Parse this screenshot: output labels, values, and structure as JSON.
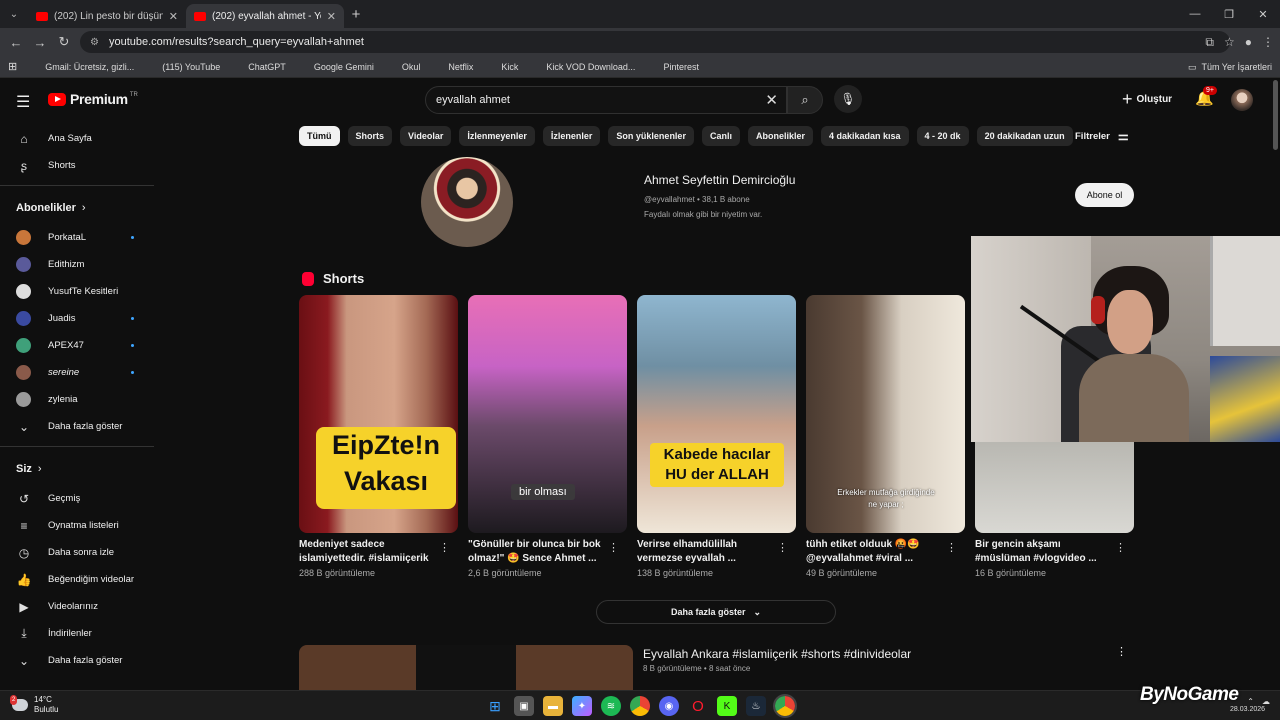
{
  "browser": {
    "tabs": [
      {
        "label": "(202) Lin pesto bir düşün - YouTube",
        "active": false
      },
      {
        "label": "(202) eyvallah ahmet - YouTube",
        "active": true
      }
    ],
    "url": "youtube.com/results?search_query=eyvallah+ahmet",
    "bookmarks": [
      {
        "label": "Gmail: Ücretsiz, gizli...",
        "color": "#4285f4"
      },
      {
        "label": "(115) YouTube",
        "color": "#ff0000"
      },
      {
        "label": "ChatGPT",
        "color": "#cfcfcf"
      },
      {
        "label": "Google Gemini",
        "color": "#7aa2ff"
      },
      {
        "label": "Okul",
        "color": "#e07b39"
      },
      {
        "label": "Netflix",
        "color": "#e50914"
      },
      {
        "label": "Kick",
        "color": "#53fc18"
      },
      {
        "label": "Kick VOD Download...",
        "color": "#9b7bff"
      },
      {
        "label": "Pinterest",
        "color": "#e60023"
      }
    ],
    "bookmarks_right": "Tüm Yer İşaretleri"
  },
  "header": {
    "logo_text": "Premium",
    "logo_sup": "TR",
    "search_value": "eyvallah ahmet",
    "create_label": "Oluştur",
    "notif_count": "9+"
  },
  "sidebar": {
    "main": [
      {
        "label": "Ana Sayfa",
        "icon": "home-icon"
      },
      {
        "label": "Shorts",
        "icon": "shorts-icon"
      }
    ],
    "subs_title": "Abonelikler",
    "subs": [
      {
        "label": "PorkataL",
        "color": "#c8763a",
        "live": true
      },
      {
        "label": "Edithizm",
        "color": "#5a5a9a",
        "live": false
      },
      {
        "label": "YusufTe Kesitleri",
        "color": "#dddddd",
        "live": false
      },
      {
        "label": "Juadis",
        "color": "#3a4aa0",
        "live": true
      },
      {
        "label": "APEX47",
        "color": "#3fa07a",
        "live": true
      },
      {
        "label": "sereine",
        "color": "#8a5a4a",
        "live": true
      },
      {
        "label": "zylenia",
        "color": "#9a9a9a",
        "live": false
      }
    ],
    "subs_more": "Daha fazla göster",
    "you_title": "Siz",
    "you": [
      {
        "label": "Geçmiş",
        "icon": "history-icon"
      },
      {
        "label": "Oynatma listeleri",
        "icon": "playlist-icon"
      },
      {
        "label": "Daha sonra izle",
        "icon": "watch-later-icon"
      },
      {
        "label": "Beğendiğim videolar",
        "icon": "like-icon"
      },
      {
        "label": "Videolarınız",
        "icon": "your-videos-icon"
      },
      {
        "label": "İndirilenler",
        "icon": "download-icon"
      }
    ],
    "you_more": "Daha fazla göster"
  },
  "chips": [
    "Tümü",
    "Shorts",
    "Videolar",
    "İzlenmeyenler",
    "İzlenenler",
    "Son yüklenenler",
    "Canlı",
    "Abonelikler",
    "4 dakikadan kısa",
    "4 - 20 dk",
    "20 dakikadan uzun"
  ],
  "filters_label": "Filtreler",
  "channel": {
    "name": "Ahmet Seyfettin Demircioğlu",
    "meta": "@eyvallahmet • 38,1 B abone",
    "description": "Faydalı olmak gibi bir niyetim var.",
    "subscribe_label": "Abone ol"
  },
  "shorts_title": "Shorts",
  "shorts": [
    {
      "title": "Medeniyet sadece\nislamiyettedir. #islamiiçerik",
      "views": "288 B görüntüleme",
      "caption": "EipZte!n\nVakası"
    },
    {
      "title": "\"Gönüller bir olunca bir bok\nolmaz!\" 🤩 Sence Ahmet ...",
      "views": "2,6 B görüntüleme",
      "caption": "bir olması"
    },
    {
      "title": "Verirse elhamdülillah\nvermezse eyvallah ...",
      "views": "138 B görüntüleme",
      "caption": "Kabede hacılar\nHU der ALLAH"
    },
    {
      "title": "tühh etiket olduuk 🤬🤩\n@eyvallahmet #viral ...",
      "views": "49 B görüntüleme",
      "caption": "Erkekler mutfağa girdiğinde\nne yapar ;"
    },
    {
      "title": "Bir gencin akşamı\n#müslüman #vlogvideo ...",
      "views": "16 B görüntüleme",
      "caption": ""
    }
  ],
  "show_more": "Daha fazla göster",
  "video": {
    "title": "Eyvallah Ankara #islamiiçerik #shorts #dinivideolar",
    "meta": "8 B görüntüleme • 8 saat önce"
  },
  "taskbar": {
    "temp": "14°C",
    "weather": "Bulutlu",
    "weather_badge": "2",
    "clock": "28.03.2026"
  },
  "watermark": "ByNoGame"
}
